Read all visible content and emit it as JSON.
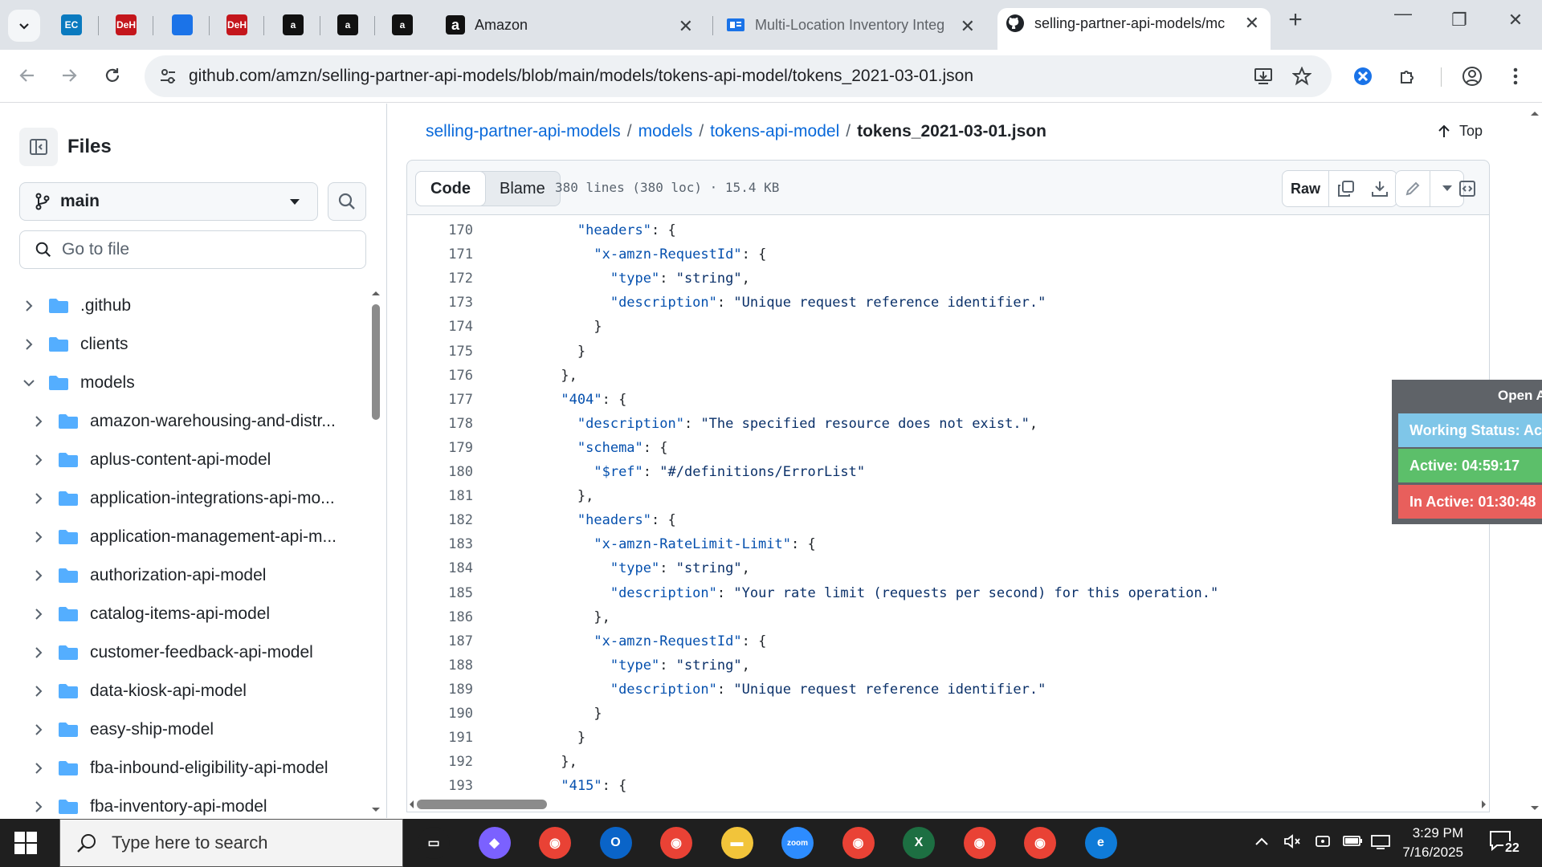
{
  "browser": {
    "pinned_tabs": [
      {
        "label": "EC",
        "color": "#0a7abf"
      },
      {
        "label": "DeH",
        "color": "#c4161c"
      },
      {
        "label": "",
        "color": "#1b73e8"
      },
      {
        "label": "DeH",
        "color": "#c4161c"
      },
      {
        "label": "a",
        "color": "#111111"
      },
      {
        "label": "a",
        "color": "#111111"
      },
      {
        "label": "a",
        "color": "#111111"
      }
    ],
    "tabs": [
      {
        "title": "Amazon",
        "active": false
      },
      {
        "title": "Multi-Location Inventory Integ",
        "active": false
      },
      {
        "title": "selling-partner-api-models/mc",
        "active": true
      }
    ],
    "url": "github.com/amzn/selling-partner-api-models/blob/main/models/tokens-api-model/tokens_2021-03-01.json"
  },
  "sidebar": {
    "title": "Files",
    "branch": "main",
    "go_to_file_placeholder": "Go to file",
    "items": [
      {
        "name": ".github",
        "expanded": false,
        "depth": 0
      },
      {
        "name": "clients",
        "expanded": false,
        "depth": 0
      },
      {
        "name": "models",
        "expanded": true,
        "depth": 0
      },
      {
        "name": "amazon-warehousing-and-distr...",
        "expanded": false,
        "depth": 1
      },
      {
        "name": "aplus-content-api-model",
        "expanded": false,
        "depth": 1
      },
      {
        "name": "application-integrations-api-mo...",
        "expanded": false,
        "depth": 1
      },
      {
        "name": "application-management-api-m...",
        "expanded": false,
        "depth": 1
      },
      {
        "name": "authorization-api-model",
        "expanded": false,
        "depth": 1
      },
      {
        "name": "catalog-items-api-model",
        "expanded": false,
        "depth": 1
      },
      {
        "name": "customer-feedback-api-model",
        "expanded": false,
        "depth": 1
      },
      {
        "name": "data-kiosk-api-model",
        "expanded": false,
        "depth": 1
      },
      {
        "name": "easy-ship-model",
        "expanded": false,
        "depth": 1
      },
      {
        "name": "fba-inbound-eligibility-api-model",
        "expanded": false,
        "depth": 1
      },
      {
        "name": "fba-inventory-api-model",
        "expanded": false,
        "depth": 1
      }
    ]
  },
  "breadcrumb": {
    "repo": "selling-partner-api-models",
    "folder1": "models",
    "folder2": "tokens-api-model",
    "file": "tokens_2021-03-01.json",
    "separator": "/"
  },
  "top_label": "Top",
  "file_header": {
    "code_tab": "Code",
    "blame_tab": "Blame",
    "meta": "380 lines (380 loc) · 15.4 KB",
    "raw_label": "Raw"
  },
  "code_lines": [
    {
      "n": "170",
      "indent": 8,
      "key": "\"headers\"",
      "rest": ": {"
    },
    {
      "n": "171",
      "indent": 10,
      "key": "\"x-amzn-RequestId\"",
      "rest": ": {"
    },
    {
      "n": "172",
      "indent": 12,
      "key": "\"type\"",
      "rest": ": ",
      "str": "\"string\"",
      "tail": ","
    },
    {
      "n": "173",
      "indent": 12,
      "key": "\"description\"",
      "rest": ": ",
      "str": "\"Unique request reference identifier.\"",
      "tail": ""
    },
    {
      "n": "174",
      "indent": 10,
      "key": "",
      "rest": "}"
    },
    {
      "n": "175",
      "indent": 8,
      "key": "",
      "rest": "}"
    },
    {
      "n": "176",
      "indent": 6,
      "key": "",
      "rest": "},"
    },
    {
      "n": "177",
      "indent": 6,
      "key": "\"404\"",
      "rest": ": {"
    },
    {
      "n": "178",
      "indent": 8,
      "key": "\"description\"",
      "rest": ": ",
      "str": "\"The specified resource does not exist.\"",
      "tail": ","
    },
    {
      "n": "179",
      "indent": 8,
      "key": "\"schema\"",
      "rest": ": {"
    },
    {
      "n": "180",
      "indent": 10,
      "key": "\"$ref\"",
      "rest": ": ",
      "str": "\"#/definitions/ErrorList\"",
      "tail": ""
    },
    {
      "n": "181",
      "indent": 8,
      "key": "",
      "rest": "},"
    },
    {
      "n": "182",
      "indent": 8,
      "key": "\"headers\"",
      "rest": ": {"
    },
    {
      "n": "183",
      "indent": 10,
      "key": "\"x-amzn-RateLimit-Limit\"",
      "rest": ": {"
    },
    {
      "n": "184",
      "indent": 12,
      "key": "\"type\"",
      "rest": ": ",
      "str": "\"string\"",
      "tail": ","
    },
    {
      "n": "185",
      "indent": 12,
      "key": "\"description\"",
      "rest": ": ",
      "str": "\"Your rate limit (requests per second) for this operation.\"",
      "tail": ""
    },
    {
      "n": "186",
      "indent": 10,
      "key": "",
      "rest": "},"
    },
    {
      "n": "187",
      "indent": 10,
      "key": "\"x-amzn-RequestId\"",
      "rest": ": {"
    },
    {
      "n": "188",
      "indent": 12,
      "key": "\"type\"",
      "rest": ": ",
      "str": "\"string\"",
      "tail": ","
    },
    {
      "n": "189",
      "indent": 12,
      "key": "\"description\"",
      "rest": ": ",
      "str": "\"Unique request reference identifier.\"",
      "tail": ""
    },
    {
      "n": "190",
      "indent": 10,
      "key": "",
      "rest": "}"
    },
    {
      "n": "191",
      "indent": 8,
      "key": "",
      "rest": "}"
    },
    {
      "n": "192",
      "indent": 6,
      "key": "",
      "rest": "},"
    },
    {
      "n": "193",
      "indent": 6,
      "key": "\"415\"",
      "rest": ": {"
    }
  ],
  "status_widget": {
    "title": "Open A",
    "working_status": "Working Status: Act",
    "active": "Active: 04:59:17",
    "inactive": "In Active: 01:30:48",
    "colors": {
      "working": "#7fc6e8",
      "active": "#5cbf6a",
      "inactive": "#e85f5c"
    }
  },
  "taskbar": {
    "search_placeholder": "Type here to search",
    "apps": [
      "task-view",
      "copilot",
      "chrome-profile-1",
      "outlook",
      "chrome-profile-2",
      "file-explorer",
      "zoom",
      "chrome",
      "excel",
      "chrome-profile-3",
      "chrome-profile-4",
      "edge"
    ],
    "time": "3:29 PM",
    "date": "7/16/2025",
    "notifications": "22"
  }
}
